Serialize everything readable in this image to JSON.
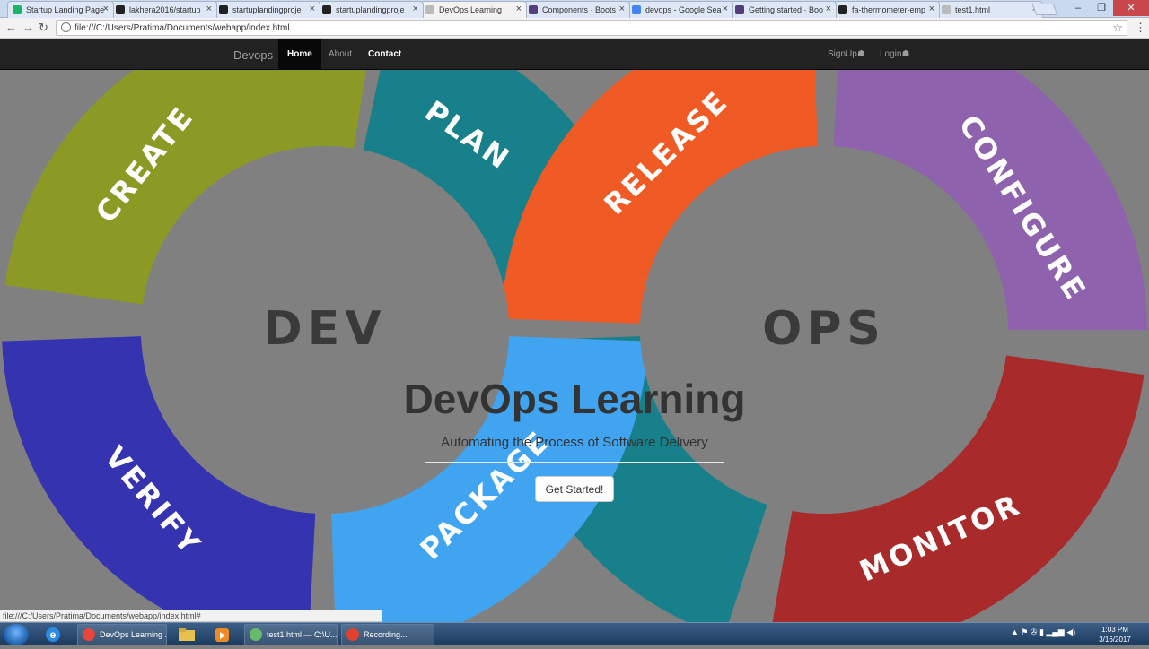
{
  "browser": {
    "tabs": [
      {
        "title": "Startup Landing Page",
        "favicon_color": "#1eb36b"
      },
      {
        "title": "lakhera2016/startup",
        "favicon_color": "#222222"
      },
      {
        "title": "startuplandingproje",
        "favicon_color": "#222222"
      },
      {
        "title": "startuplandingproje",
        "favicon_color": "#222222"
      },
      {
        "title": "DevOps Learning",
        "favicon_color": "#bbbbbb",
        "active": true
      },
      {
        "title": "Components · Boots",
        "favicon_color": "#563d7c"
      },
      {
        "title": "devops - Google Sea",
        "favicon_color": "#4285f4"
      },
      {
        "title": "Getting started · Boo",
        "favicon_color": "#563d7c"
      },
      {
        "title": "fa-thermometer-emp",
        "favicon_color": "#222222"
      },
      {
        "title": "test1.html",
        "favicon_color": "#bbbbbb"
      }
    ],
    "close_glyph": "×",
    "window_controls": {
      "minimize": "–",
      "maximize": "❐",
      "close": "✕"
    },
    "nav": {
      "back": "←",
      "forward": "→",
      "reload": "↻"
    },
    "url": "file:///C:/Users/Pratima/Documents/webapp/index.html",
    "info_glyph": "i",
    "star_glyph": "☆",
    "menu_glyph": "⋮"
  },
  "navbar": {
    "brand": "Devops",
    "links": [
      {
        "label": "Home",
        "active": true
      },
      {
        "label": "About"
      },
      {
        "label": "Contact"
      }
    ],
    "right_links": [
      {
        "label": "SignUp",
        "icon": "user-icon"
      },
      {
        "label": "Login",
        "icon": "user-icon"
      }
    ],
    "user_glyph": "☗"
  },
  "hero": {
    "loop": {
      "segments": [
        {
          "label": "CREATE",
          "color": "#8b9a25"
        },
        {
          "label": "PLAN",
          "color": "#17808a"
        },
        {
          "label": "VERIFY",
          "color": "#3533b0"
        },
        {
          "label": "PACKAGE",
          "color": "#41a4f0"
        },
        {
          "label": "RELEASE",
          "color": "#f05a24"
        },
        {
          "label": "CONFIGURE",
          "color": "#8e62ad"
        },
        {
          "label": "MONITOR",
          "color": "#a82a2a"
        }
      ],
      "left_label": "DEV",
      "right_label": "OPS",
      "background": "#808080"
    },
    "title": "DevOps Learning",
    "subtitle": "Automating the Process of Software Delivery",
    "cta_label": "Get Started!"
  },
  "status_url": "file:///C:/Users/Pratima/Documents/webapp/index.html#",
  "taskbar": {
    "items": [
      {
        "label": "DevOps Learning ...",
        "icon": "chrome-icon",
        "color": "#e8453c"
      },
      {
        "label": "test1.html — C:\\U...",
        "icon": "atom-icon",
        "color": "#66bb6a"
      },
      {
        "label": "Recording...",
        "icon": "recorder-icon",
        "color": "#e0422d"
      }
    ],
    "tray_glyphs": "▲ ⚑ ✇ ▮ ▂▄▆ ◀)",
    "time": "1:03 PM",
    "date": "3/16/2017"
  }
}
